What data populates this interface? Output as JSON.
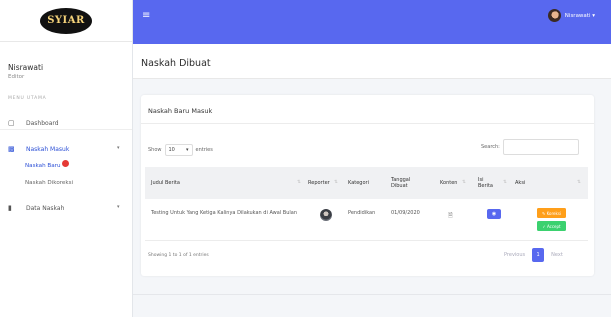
{
  "brand": {
    "logo_text": "SYIAR"
  },
  "sidebar": {
    "user_name": "Nisrawati",
    "user_role": "Editor",
    "menu_heading": "MENU UTAMA",
    "items": [
      {
        "label": "Dashboard",
        "icon": "monitor-icon"
      },
      {
        "label": "Naskah Masuk",
        "icon": "inbox-icon"
      },
      {
        "label": "Data Naskah",
        "icon": "document-icon"
      }
    ],
    "sub_items": [
      {
        "label": "Naskah Baru",
        "badge": ""
      },
      {
        "label": "Naskah Dikoreksi"
      }
    ]
  },
  "topbar": {
    "menu_icon": "hamburger-icon",
    "user_label": "Nisrawati ▾",
    "color": "#5868ef"
  },
  "page": {
    "title": "Naskah Dibuat"
  },
  "card": {
    "title": "Naskah Baru Masuk",
    "show_label": "Show",
    "entries_value": "10",
    "entries_label": "entries",
    "search_label": "Search:",
    "search_value": ""
  },
  "table": {
    "columns": [
      "Judul Berita",
      "Reporter",
      "Kategori",
      "Tanggal Dibuat",
      "Konten",
      "Isi Berita",
      "Aksi"
    ],
    "rows": [
      {
        "judul": "Testing Untuk Yang Ketiga Kalinya Dilakukan di Awal Bulan",
        "kategori": "Pendidikan",
        "tanggal": "01/09/2020",
        "koreksi_label": "Koreksi",
        "accept_label": "Accept"
      }
    ]
  },
  "footer": {
    "showing": "Showing 1 to 1 of 1 entries",
    "previous": "Previous",
    "page": "1",
    "next": "Next"
  },
  "colors": {
    "accent": "#5868ef",
    "warning": "#ff9f1a",
    "success": "#3bd16f"
  }
}
